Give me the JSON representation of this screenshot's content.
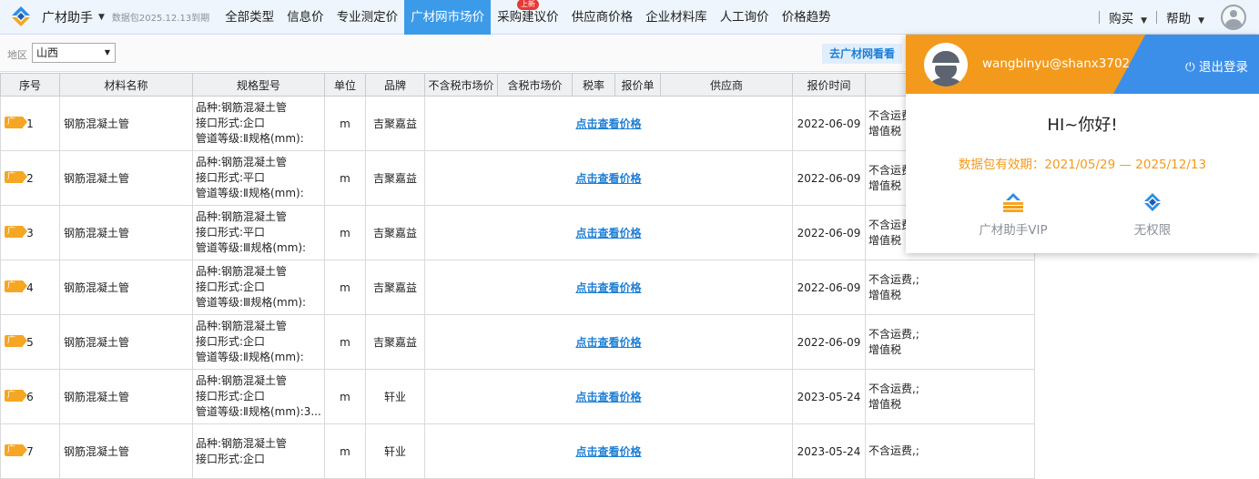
{
  "app": {
    "name": "广材助手",
    "package_note": "数据包2025.12.13到期"
  },
  "nav": {
    "items": [
      {
        "label": "全部类型"
      },
      {
        "label": "信息价"
      },
      {
        "label": "专业测定价"
      },
      {
        "label": "广材网市场价",
        "active": true
      },
      {
        "label": "采购建议价",
        "badge": "上新"
      },
      {
        "label": "供应商价格"
      },
      {
        "label": "企业材料库"
      },
      {
        "label": "人工询价"
      },
      {
        "label": "价格趋势"
      }
    ],
    "buy": "购买",
    "help": "帮助"
  },
  "filter": {
    "region_label": "地区",
    "region_value": "山西",
    "goto_button": "去广材网看看"
  },
  "table": {
    "columns": [
      "序号",
      "材料名称",
      "规格型号",
      "单位",
      "品牌",
      "不含税市场价",
      "含税市场价",
      "税率",
      "报价单",
      "供应商",
      "报价时间",
      ""
    ],
    "rows": [
      {
        "tag": "广",
        "idx": "1",
        "name": "钢筋混凝土管",
        "spec": [
          "品种:钢筋混凝土管",
          "接口形式:企口",
          "管道等级:Ⅱ规格(mm):"
        ],
        "unit": "m",
        "brand": "吉聚嘉益",
        "price_link": "点击查看价格",
        "date": "2022-06-09",
        "note": [
          "不含运费,;",
          "增值税"
        ]
      },
      {
        "tag": "广",
        "idx": "2",
        "name": "钢筋混凝土管",
        "spec": [
          "品种:钢筋混凝土管",
          "接口形式:平口",
          "管道等级:Ⅱ规格(mm):"
        ],
        "unit": "m",
        "brand": "吉聚嘉益",
        "price_link": "点击查看价格",
        "date": "2022-06-09",
        "note": [
          "不含运费,;",
          "增值税"
        ]
      },
      {
        "tag": "广",
        "idx": "3",
        "name": "钢筋混凝土管",
        "spec": [
          "品种:钢筋混凝土管",
          "接口形式:平口",
          "管道等级:Ⅲ规格(mm):"
        ],
        "unit": "m",
        "brand": "吉聚嘉益",
        "price_link": "点击查看价格",
        "date": "2022-06-09",
        "note": [
          "不含运费,;",
          "增值税"
        ]
      },
      {
        "tag": "广",
        "idx": "4",
        "name": "钢筋混凝土管",
        "spec": [
          "品种:钢筋混凝土管",
          "接口形式:企口",
          "管道等级:Ⅲ规格(mm):"
        ],
        "unit": "m",
        "brand": "吉聚嘉益",
        "price_link": "点击查看价格",
        "date": "2022-06-09",
        "note": [
          "不含运费,;",
          "增值税"
        ]
      },
      {
        "tag": "广",
        "idx": "5",
        "name": "钢筋混凝土管",
        "spec": [
          "品种:钢筋混凝土管",
          "接口形式:企口",
          "管道等级:Ⅱ规格(mm):"
        ],
        "unit": "m",
        "brand": "吉聚嘉益",
        "price_link": "点击查看价格",
        "date": "2022-06-09",
        "note": [
          "不含运费,;",
          "增值税"
        ]
      },
      {
        "tag": "广",
        "idx": "6",
        "name": "钢筋混凝土管",
        "spec": [
          "品种:钢筋混凝土管",
          "接口形式:企口",
          "管道等级:Ⅱ规格(mm):3..."
        ],
        "unit": "m",
        "brand": "轩业",
        "price_link": "点击查看价格",
        "date": "2023-05-24",
        "note": [
          "不含运费,;",
          "增值税"
        ]
      },
      {
        "tag": "广",
        "idx": "7",
        "name": "钢筋混凝土管",
        "spec": [
          "品种:钢筋混凝土管",
          "接口形式:企口",
          ""
        ],
        "unit": "m",
        "brand": "轩业",
        "price_link": "点击查看价格",
        "date": "2023-05-24",
        "note": [
          "不含运费,;",
          ""
        ]
      }
    ]
  },
  "user_popup": {
    "username": "wangbinyu@shanx3702",
    "logout": "退出登录",
    "greeting": "HI~你好!",
    "validity": "数据包有效期：2021/05/29 — 2025/12/13",
    "permissions": [
      {
        "label": "广材助手VIP",
        "icon": "vip-building-icon"
      },
      {
        "label": "无权限",
        "icon": "app-logo-icon"
      }
    ]
  },
  "colors": {
    "nav_active": "#3c9be9",
    "popup_orange": "#f39a1c",
    "popup_blue": "#3c8fe8",
    "link_blue": "#1f7fd4",
    "tag_orange": "#f5a623"
  }
}
